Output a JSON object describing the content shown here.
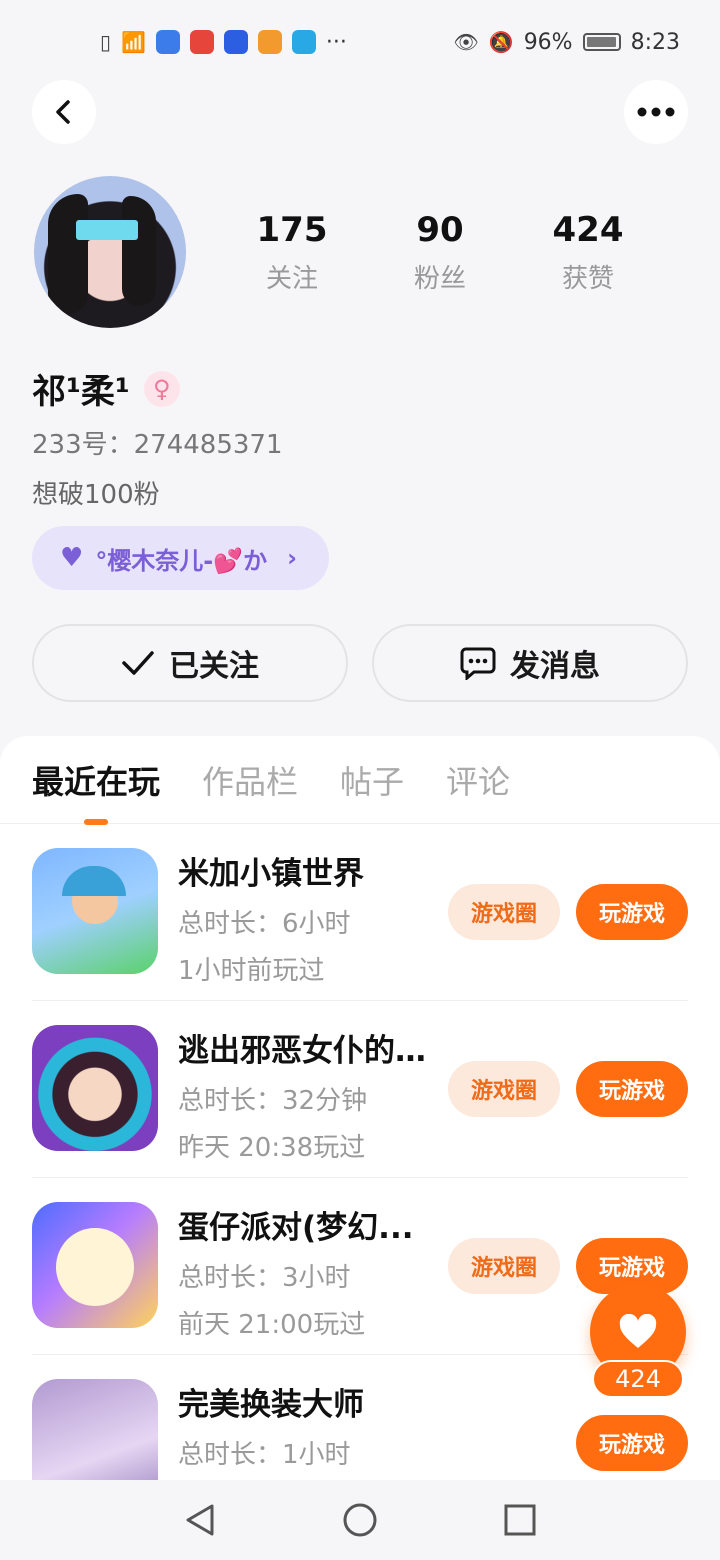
{
  "status_bar": {
    "battery": "96%",
    "time": "8:23",
    "more": "···"
  },
  "header": {
    "back_icon": "back-arrow-icon",
    "more_icon": "more-dots-icon"
  },
  "profile": {
    "stats": [
      {
        "num": "175",
        "label": "关注"
      },
      {
        "num": "90",
        "label": "粉丝"
      },
      {
        "num": "424",
        "label": "获赞"
      }
    ],
    "name": "祁¹柔¹",
    "gender_icon": "female-icon",
    "user_id": "233号：274485371",
    "bio": "想破100粉",
    "tag": {
      "text": "°樱木奈儿-💕か"
    }
  },
  "actions": {
    "follow_label": "已关注",
    "message_label": "发消息"
  },
  "tabs": [
    "最近在玩",
    "作品栏",
    "帖子",
    "评论"
  ],
  "games": [
    {
      "name": "米加小镇世界",
      "duration": "总时长：6小时",
      "last": "1小时前玩过",
      "circle": "游戏圈",
      "play": "玩游戏",
      "colors": [
        "#7fb7ff",
        "#5ad16a"
      ]
    },
    {
      "name": "逃出邪恶女仆的...",
      "duration": "总时长：32分钟",
      "last": "昨天 20:38玩过",
      "circle": "游戏圈",
      "play": "玩游戏",
      "colors": [
        "#7b3fbf",
        "#2ab7d9"
      ]
    },
    {
      "name": "蛋仔派对(梦幻...",
      "duration": "总时长：3小时",
      "last": "前天 21:00玩过",
      "circle": "游戏圈",
      "play": "玩游戏",
      "colors": [
        "#4d6cff",
        "#ffd25a"
      ]
    },
    {
      "name": "完美换装大师",
      "duration": "总时长：1小时",
      "last": "",
      "circle": "",
      "play": "玩游戏",
      "colors": [
        "#b29ad1",
        "#e6d6f3"
      ]
    }
  ],
  "floating_like": {
    "count": "424"
  },
  "colors": {
    "accent": "#ff6d10",
    "accent_light": "#fde8dc",
    "tag_bg": "#e7e3fb"
  }
}
